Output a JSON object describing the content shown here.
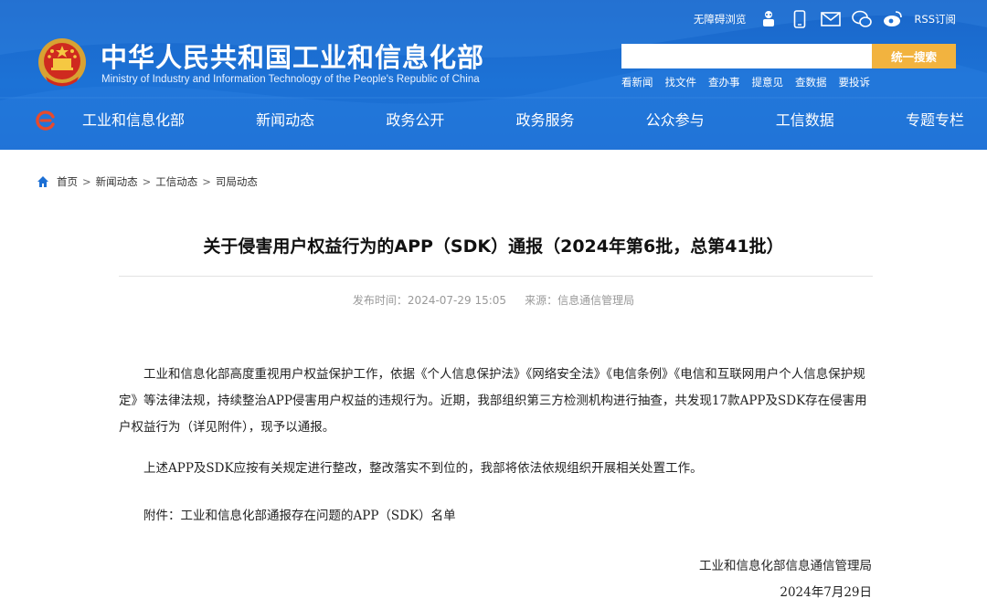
{
  "header": {
    "site_title": "中华人民共和国工业和信息化部",
    "site_subtitle": "Ministry of Industry and Information Technology of the People's Republic of China",
    "barrier_free": "无障碍浏览",
    "rss": "RSS订阅",
    "top_icons": [
      "robot-icon",
      "mobile-icon",
      "mail-icon",
      "wechat-icon",
      "weibo-icon"
    ],
    "search": {
      "value": "",
      "placeholder": "",
      "button": "统一搜索"
    },
    "quick_links": [
      "看新闻",
      "找文件",
      "查办事",
      "提意见",
      "查数据",
      "要投诉"
    ],
    "colors": {
      "header_bg": "#1c6fd4",
      "search_button": "#f2b33f"
    }
  },
  "nav": {
    "items": [
      "工业和信息化部",
      "新闻动态",
      "政务公开",
      "政务服务",
      "公众参与",
      "工信数据",
      "专题专栏"
    ]
  },
  "breadcrumb": [
    "首页",
    "新闻动态",
    "工信动态",
    "司局动态"
  ],
  "article": {
    "title": "关于侵害用户权益行为的APP（SDK）通报（2024年第6批，总第41批）",
    "publish_time": "发布时间：2024-07-29 15:05",
    "source": "来源：信息通信管理局",
    "paragraphs": [
      "工业和信息化部高度重视用户权益保护工作，依据《个人信息保护法》《网络安全法》《电信条例》《电信和互联网用户个人信息保护规定》等法律法规，持续整治APP侵害用户权益的违规行为。近期，我部组织第三方检测机构进行抽查，共发现17款APP及SDK存在侵害用户权益行为（详见附件），现予以通报。",
      "上述APP及SDK应按有关规定进行整改，整改落实不到位的，我部将依法依规组织开展相关处置工作。",
      "附件：工业和信息化部通报存在问题的APP（SDK）名单"
    ],
    "signature": "工业和信息化部信息通信管理局",
    "date": "2024年7月29日"
  }
}
